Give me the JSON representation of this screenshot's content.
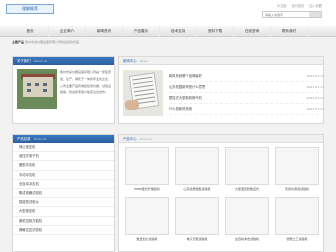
{
  "header": {
    "logo_text": "理解推荐",
    "top_links": [
      "中文版",
      "设为首页",
      "加入收藏"
    ],
    "search_placeholder": "请输入关键字"
  },
  "nav": [
    "首页",
    "企业简介",
    "新闻资讯",
    "产品展示",
    "技术支持",
    "资料下载",
    "在线咨询",
    "联系我们"
  ],
  "breadcrumb": {
    "label": "主题产品",
    "text": "扬州市某仪器设备有限公司欢迎您的光临"
  },
  "about": {
    "title": "关于我们",
    "title_en": "About Us",
    "text": "扬州市某仪器设备有限公司是一家集研发、生产、销售于一体的专业化企业，公司主要产品有电缆检测仪器、试验设备等，欢迎新老客户前来洽谈合作。"
  },
  "news": {
    "title": "新闻中心",
    "title_en": "News",
    "items": [
      {
        "title": "新风系统哪个品牌最好",
        "date": "2021-03-11"
      },
      {
        "title": "山东校园新风是什么意思",
        "date": "2021-03-11"
      },
      {
        "title": "壁挂式大型新风换气机",
        "date": "2021-03-11"
      },
      {
        "title": "什么是新风系统",
        "date": "2021-03-11"
      }
    ]
  },
  "categories": {
    "title": "产品目录",
    "title_en": "Products",
    "items": [
      "静止液压机",
      "液压式电子机",
      "微型冲击机",
      "手动冲击机",
      "全自动冲击机",
      "集成电器试验机",
      "智能型试验仪",
      "大型液压机",
      "微机控制万能机",
      "弹簧拉压试验机"
    ]
  },
  "products": {
    "title": "产品中心",
    "title_en": "Products",
    "items": [
      "HMW型光纤熔接机",
      "山东优质微型试验机",
      "大型液压机数显式",
      "天然水源滤试验机",
      "数显加力试验机",
      "电子万能试验机",
      "全自动冲击试验机",
      "智能土工试验机"
    ]
  }
}
